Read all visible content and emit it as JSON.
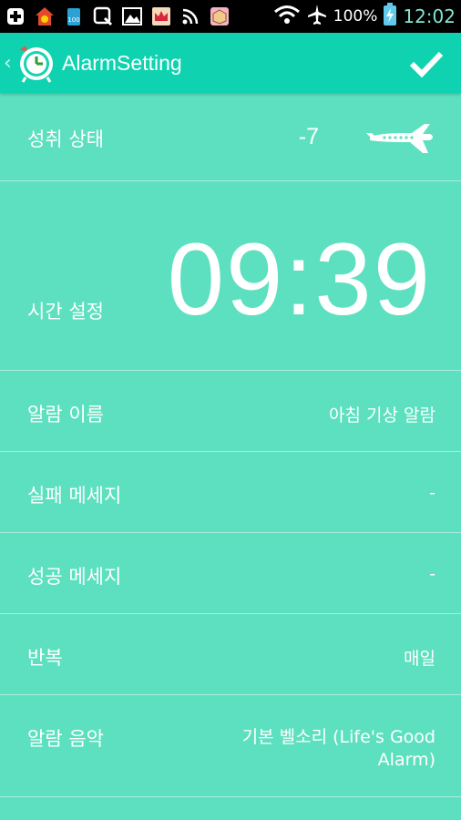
{
  "status_bar": {
    "battery_percent": "100%",
    "time": "12:02",
    "badge_count": "100"
  },
  "app_bar": {
    "title": "AlarmSetting"
  },
  "rows": {
    "status": {
      "label": "성취 상태",
      "value": "-7"
    },
    "time": {
      "label": "시간 설정",
      "value": "09:39"
    },
    "name": {
      "label": "알람 이름",
      "value": "아침 기상 알람"
    },
    "fail_message": {
      "label": "실패 메세지",
      "value": "-"
    },
    "success_message": {
      "label": "성공 메세지",
      "value": "-"
    },
    "repeat": {
      "label": "반복",
      "value": "매일"
    },
    "music": {
      "label": "알람 음악",
      "value": "기본 벨소리 (Life's Good Alarm)"
    }
  },
  "colors": {
    "app_bar": "#0fd3b0",
    "background": "#5de0bf",
    "divider": "#a9eedc",
    "text": "#ffffff"
  }
}
